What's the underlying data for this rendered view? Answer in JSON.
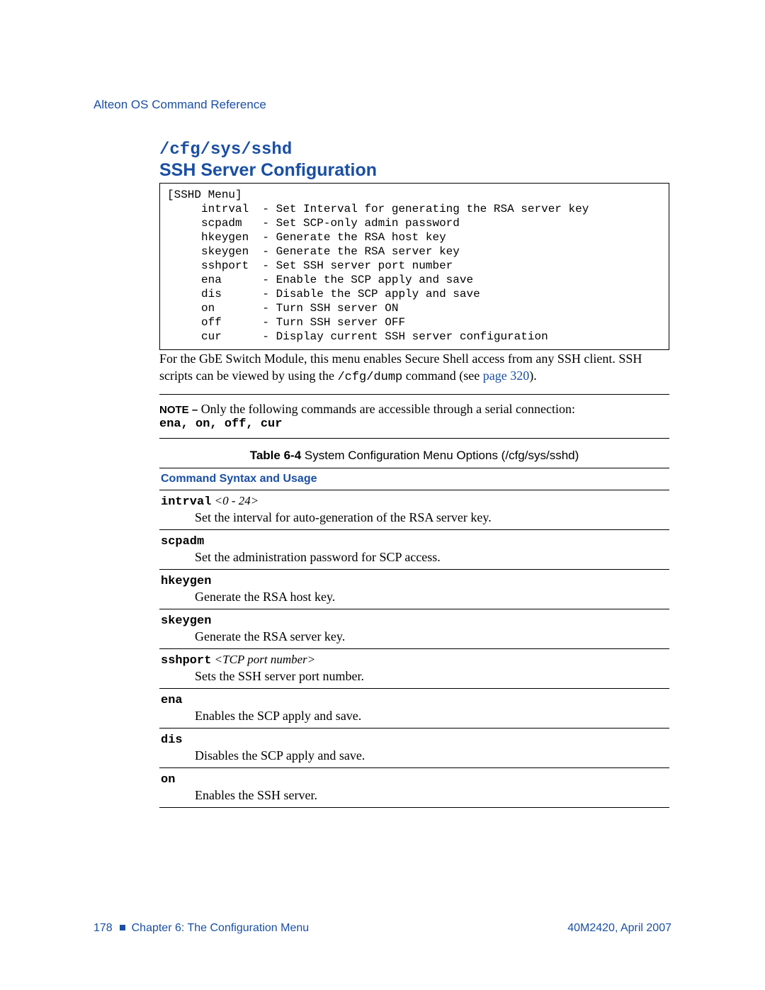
{
  "header": "Alteon OS Command Reference",
  "title": {
    "path": "/cfg/sys/sshd",
    "main": "SSH Server Configuration"
  },
  "codebox": "[SSHD Menu]\n     intrval  - Set Interval for generating the RSA server key\n     scpadm   - Set SCP-only admin password\n     hkeygen  - Generate the RSA host key\n     skeygen  - Generate the RSA server key\n     sshport  - Set SSH server port number\n     ena      - Enable the SCP apply and save\n     dis      - Disable the SCP apply and save\n     on       - Turn SSH server ON\n     off      - Turn SSH server OFF\n     cur      - Display current SSH server configuration",
  "paragraph": {
    "pre": "For the GbE Switch Module, this menu enables Secure Shell access from any SSH client. SSH scripts can be viewed by using the ",
    "mono": "/cfg/dump",
    "mid": " command (see ",
    "link": "page 320",
    "post": ")."
  },
  "note": {
    "label": "NOTE –",
    "text": " Only the following commands are accessible through a serial connection:",
    "cmds": "ena, on, off, cur"
  },
  "table": {
    "caption_bold": "Table 6-4",
    "caption_rest": "  System Configuration Menu Options (/cfg/sys/sshd)",
    "header": "Command Syntax and Usage",
    "rows": [
      {
        "syntax": "intrval",
        "arg": "  <0 - 24>",
        "desc": "Set the interval for auto-generation of the RSA server key."
      },
      {
        "syntax": "scpadm",
        "arg": "",
        "desc": "Set the administration password for SCP access."
      },
      {
        "syntax": "hkeygen",
        "arg": "",
        "desc": "Generate the RSA host key."
      },
      {
        "syntax": "skeygen",
        "arg": "",
        "desc": "Generate the RSA server key."
      },
      {
        "syntax": "sshport",
        "arg": "  <TCP port number>",
        "desc": "Sets the SSH server port number."
      },
      {
        "syntax": "ena",
        "arg": "",
        "desc": "Enables the SCP apply and save."
      },
      {
        "syntax": "dis",
        "arg": "",
        "desc": "Disables the SCP apply and save."
      },
      {
        "syntax": "on",
        "arg": "",
        "desc": "Enables the SSH server."
      }
    ]
  },
  "footer": {
    "page": "178",
    "chapter": "Chapter 6:  The Configuration Menu",
    "right": "40M2420, April 2007"
  }
}
